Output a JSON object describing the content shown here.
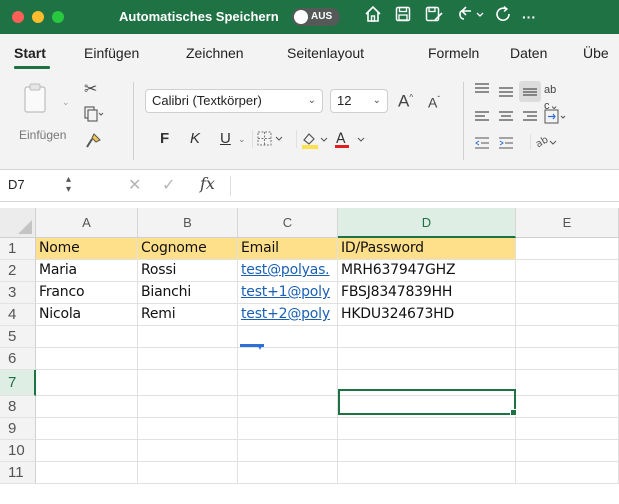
{
  "titlebar": {
    "autosave_label": "Automatisches Speichern",
    "autosave_state": "AUS",
    "ellipsis": "···"
  },
  "tabs": [
    "Start",
    "Einfügen",
    "Zeichnen",
    "Seitenlayout",
    "Formeln",
    "Daten",
    "Übe"
  ],
  "active_tab": "Start",
  "ribbon": {
    "paste_label": "Einfügen",
    "font_name": "Calibri (Textkörper)",
    "font_size": "12",
    "bold": "F",
    "italic": "K",
    "underline": "U",
    "grow_font": "A",
    "shrink_font": "A"
  },
  "formula_bar": {
    "cell_ref": "D7",
    "content": ""
  },
  "grid": {
    "columns": [
      "A",
      "B",
      "C",
      "D",
      "E"
    ],
    "selected_column": "D",
    "rows": [
      "1",
      "2",
      "3",
      "4",
      "5",
      "6",
      "7",
      "8",
      "9",
      "10",
      "11"
    ],
    "selected_row": "7",
    "header_row": [
      "Nome",
      "Cognome",
      "Email",
      "ID/Password"
    ],
    "data": [
      [
        "Maria",
        "Rossi",
        "test@polyas.",
        "MRH637947GHZ"
      ],
      [
        "Franco",
        "Bianchi",
        "test+1@poly",
        "FBSJ8347839HH"
      ],
      [
        "Nicola",
        "Remi",
        "test+2@poly",
        "HKDU324673HD"
      ]
    ]
  },
  "colors": {
    "accent": "#1f7244",
    "header_fill": "#ffe08a",
    "link": "#1a5fb4"
  }
}
